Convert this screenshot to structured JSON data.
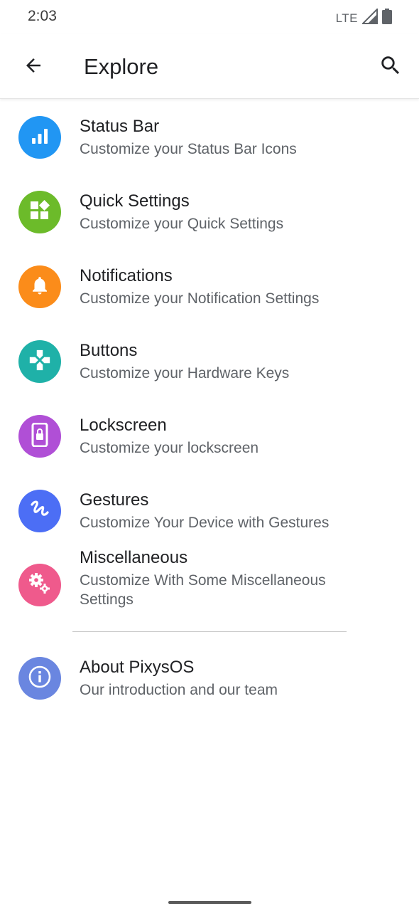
{
  "status_bar": {
    "time": "2:03",
    "network": "LTE"
  },
  "app_bar": {
    "title": "Explore",
    "back_icon": "arrow-back-icon",
    "search_icon": "search-icon"
  },
  "items": [
    {
      "title": "Status Bar",
      "subtitle": "Customize your Status Bar Icons",
      "icon": "signal-bars-icon",
      "color": "#2196f3"
    },
    {
      "title": "Quick Settings",
      "subtitle": "Customize your Quick Settings",
      "icon": "tiles-icon",
      "color": "#6cbb2a"
    },
    {
      "title": "Notifications",
      "subtitle": "Customize your Notification Settings",
      "icon": "bell-icon",
      "color": "#fb8c1a"
    },
    {
      "title": "Buttons",
      "subtitle": "Customize your Hardware Keys",
      "icon": "gamepad-icon",
      "color": "#1fb1a8"
    },
    {
      "title": "Lockscreen",
      "subtitle": "Customize your lockscreen",
      "icon": "phone-lock-icon",
      "color": "#b04fd6"
    },
    {
      "title": "Gestures",
      "subtitle": "Customize Your Device with Gestures",
      "icon": "gesture-icon",
      "color": "#4c6ef5"
    },
    {
      "title": "Miscellaneous",
      "subtitle": "Customize With Some Miscellaneous Settings",
      "icon": "gears-icon",
      "color": "#ef5a8c"
    },
    {
      "title": "About PixysOS",
      "subtitle": "Our introduction and our team",
      "icon": "info-icon",
      "color": "#6a86e0"
    }
  ]
}
